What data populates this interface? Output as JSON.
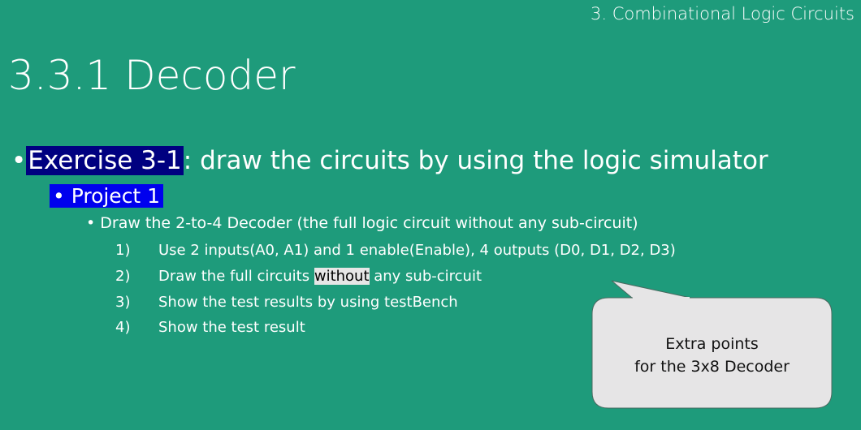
{
  "header": {
    "section": "3. Combinational Logic Circuits",
    "title": "3.3.1 Decoder"
  },
  "content": {
    "exercise_label": "Exercise 3-1",
    "exercise_text": ": draw the circuits by using the logic simulator",
    "project": "Project 1",
    "task": "Draw the 2-to-4 Decoder (the full logic circuit without any sub-circuit)",
    "items": [
      {
        "num": "1)",
        "text": "Use 2 inputs(A0, A1) and 1 enable(Enable), 4 outputs (D0, D1, D2, D3)"
      },
      {
        "num": "2)",
        "pre": "Draw the full circuits ",
        "hl": "without",
        "post": " any sub-circuit"
      },
      {
        "num": "3)",
        "text": "Show the test results by using testBench"
      },
      {
        "num": "4)",
        "text": "Show the test result"
      }
    ]
  },
  "callout": {
    "line1": "Extra points",
    "line2": "for the 3x8 Decoder"
  },
  "colors": {
    "background": "#1e9b7b",
    "exercise_highlight": "#000080",
    "project_highlight": "#0000ee",
    "callout": "#e6e5e6"
  }
}
